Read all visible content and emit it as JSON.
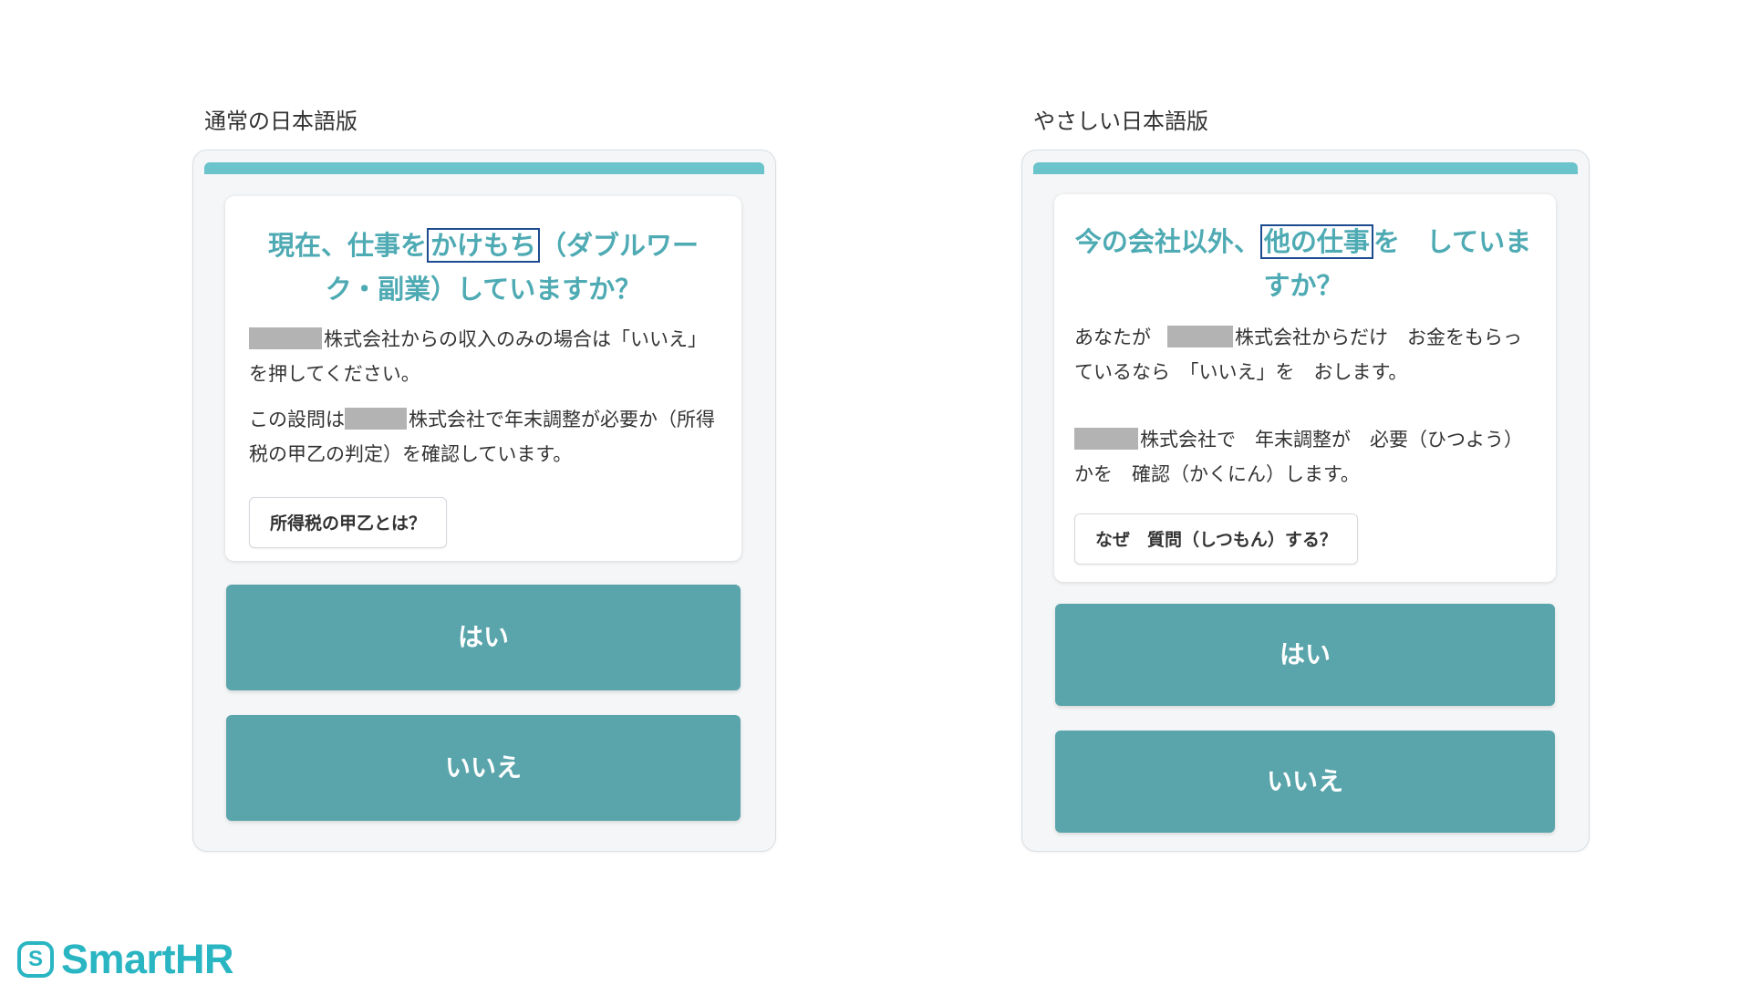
{
  "left": {
    "caption": "通常の日本語版",
    "question_pre": "現在、仕事を",
    "question_hl": "かけもち",
    "question_post": "（ダブルワーク・副業）していますか？",
    "desc1_post": "株式会社からの収入のみの場合は「いいえ」を押してください。",
    "desc2_pre": "この設問は",
    "desc2_post": "株式会社で年末調整が必要か（所得税の甲乙の判定）を確認しています。",
    "help_button": "所得税の甲乙とは？",
    "yes_button": "はい",
    "no_button": "いいえ"
  },
  "right": {
    "caption": "やさしい日本語版",
    "question_pre": "今の会社以外、",
    "question_hl": "他の仕事",
    "question_post": "を　していますか？",
    "desc1_pre": "あなたが",
    "desc1_post": "株式会社からだけ　お金をもらっているなら　「いいえ」を　おします。",
    "desc2_post": "株式会社で　年末調整が　必要（ひつよう）かを　確認（かくにん）します。",
    "help_button": "なぜ　質問（しつもん）する？",
    "yes_button": "はい",
    "no_button": "いいえ"
  },
  "logo": {
    "mark": "S",
    "text": "SmartHR"
  },
  "colors": {
    "accent": "#4eaab3",
    "button": "#5aa5ab",
    "topbar": "#6bc3cb",
    "highlight_border": "#1d4b8f",
    "redaction": "#b3b3b3",
    "logo": "#29b5c2"
  }
}
